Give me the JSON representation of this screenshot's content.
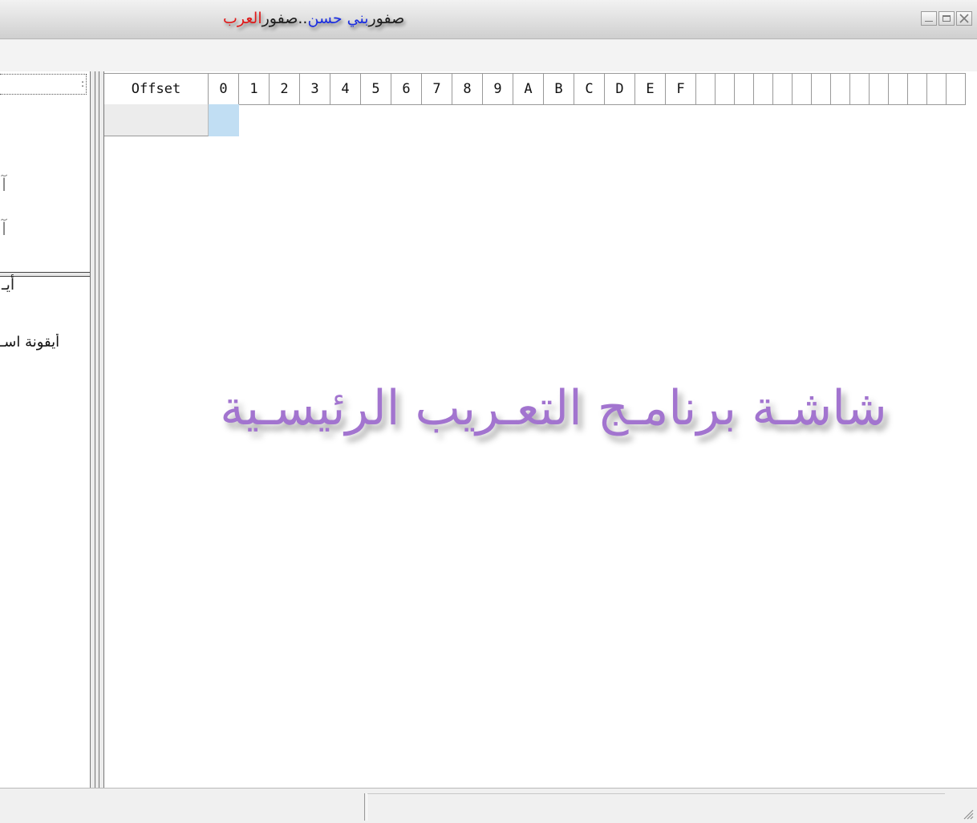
{
  "window": {
    "title_parts": [
      {
        "text": "صفور",
        "color": "#1d1d1d"
      },
      {
        "text": "بني حسن",
        "color": "#1b2ee0"
      },
      {
        "text": "..صفور",
        "color": "#1d1d1d"
      },
      {
        "text": "العرب",
        "color": "#e01818"
      }
    ],
    "controls": [
      "minimize-icon",
      "maximize-icon",
      "close-icon"
    ]
  },
  "left_panel": {
    "glyph_1": "ﺁ",
    "glyph_2": "ﺁ",
    "split_label": "أيـ",
    "item_text": "أيقونة اسـ"
  },
  "hex_grid": {
    "offset_header": "Offset",
    "columns": [
      "0",
      "1",
      "2",
      "3",
      "4",
      "5",
      "6",
      "7",
      "8",
      "9",
      "A",
      "B",
      "C",
      "D",
      "E",
      "F"
    ],
    "extra_empty_columns": 14
  },
  "main": {
    "watermark": "شاشـة برنامـج التعـريب الرئيسـية"
  },
  "colors": {
    "watermark": "#a274cf",
    "selected_cell": "#c1def3"
  }
}
